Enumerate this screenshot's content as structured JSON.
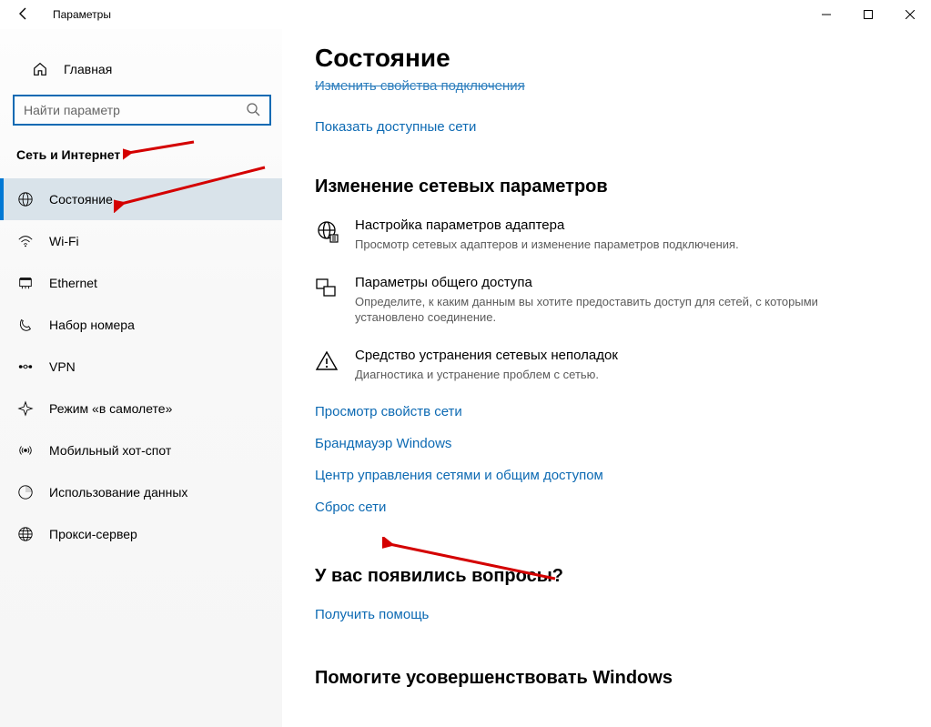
{
  "titlebar": {
    "title": "Параметры"
  },
  "sidebar": {
    "home": "Главная",
    "search_placeholder": "Найти параметр",
    "section": "Сеть и Интернет",
    "items": [
      {
        "id": "status",
        "label": "Состояние",
        "active": true
      },
      {
        "id": "wifi",
        "label": "Wi-Fi",
        "active": false
      },
      {
        "id": "ethernet",
        "label": "Ethernet",
        "active": false
      },
      {
        "id": "dialup",
        "label": "Набор номера",
        "active": false
      },
      {
        "id": "vpn",
        "label": "VPN",
        "active": false
      },
      {
        "id": "airplane",
        "label": "Режим «в самолете»",
        "active": false
      },
      {
        "id": "hotspot",
        "label": "Мобильный хот-спот",
        "active": false
      },
      {
        "id": "datausage",
        "label": "Использование данных",
        "active": false
      },
      {
        "id": "proxy",
        "label": "Прокси-сервер",
        "active": false
      }
    ]
  },
  "content": {
    "title": "Состояние",
    "cut_link": "Изменить свойства подключения",
    "show_networks": "Показать доступные сети",
    "change_heading": "Изменение сетевых параметров",
    "options": [
      {
        "title": "Настройка параметров адаптера",
        "desc": "Просмотр сетевых адаптеров и изменение параметров подключения."
      },
      {
        "title": "Параметры общего доступа",
        "desc": "Определите, к каким данным вы хотите предоставить доступ для сетей, с которыми установлено соединение."
      },
      {
        "title": "Средство устранения сетевых неполадок",
        "desc": "Диагностика и устранение проблем с сетью."
      }
    ],
    "links": [
      "Просмотр свойств сети",
      "Брандмауэр Windows",
      "Центр управления сетями и общим доступом",
      "Сброс сети"
    ],
    "questions_heading": "У вас появились вопросы?",
    "get_help": "Получить помощь",
    "improve_heading": "Помогите усовершенствовать Windows"
  },
  "colors": {
    "accent": "#0078d4",
    "link": "#0d6ab3"
  }
}
